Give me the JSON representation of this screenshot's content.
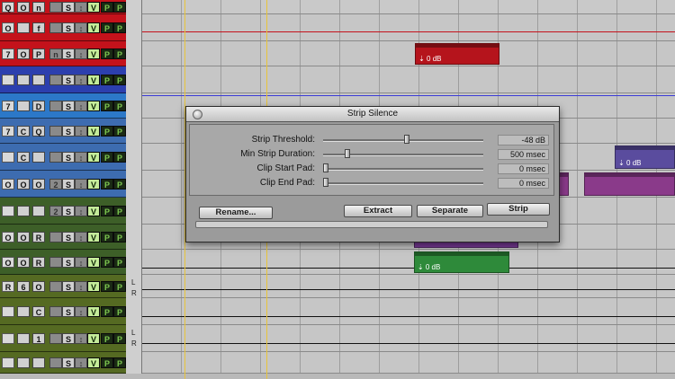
{
  "tracks": [
    {
      "color": "#c4121b",
      "num": "Q",
      "b1": "O",
      "b2": "n",
      "h": 16,
      "lane": "#c9c9c9"
    },
    {
      "color": "#c4121b",
      "num": "O",
      "b1": "",
      "b2": "f",
      "h": 30,
      "lane": "#c6c6c6"
    },
    {
      "color": "#c4121b",
      "num": "7",
      "b1": "O",
      "b2": "P",
      "b3": "n",
      "h": 28,
      "lane": "#c6c6c6"
    },
    {
      "color": "#2c3fae",
      "num": "",
      "b1": "",
      "b2": "",
      "h": 30,
      "lane": "#c6c6c6"
    },
    {
      "color": "#2c78c8",
      "num": "7",
      "b1": "",
      "b2": "D",
      "b3": "",
      "h": 28,
      "lane": "#c6c6c6"
    },
    {
      "color": "#3d6cb0",
      "num": "7",
      "b1": "C",
      "b2": "Q",
      "b3": "",
      "h": 28,
      "lane": "#c6c6c6"
    },
    {
      "color": "#3d6cb0",
      "num": "",
      "b1": "C",
      "b2": "",
      "b3": "",
      "h": 30,
      "lane": "#c6c6c6"
    },
    {
      "color": "#3d6cb0",
      "num": "O",
      "b1": "O",
      "b2": "O",
      "b3": "2",
      "h": 30,
      "lane": "#c6c6c6"
    },
    {
      "color": "#3d5f28",
      "num": "",
      "b1": "",
      "b2": "",
      "b3": "2",
      "h": 30,
      "lane": "#c6c6c6"
    },
    {
      "color": "#3d5f28",
      "num": "O",
      "b1": "O",
      "b2": "R",
      "b3": "",
      "h": 28,
      "lane": "#c6c6c6"
    },
    {
      "color": "#3d5f28",
      "num": "O",
      "b1": "O",
      "b2": "R",
      "b3": "",
      "h": 28,
      "lane": "#c6c6c6"
    },
    {
      "color": "#556a22",
      "num": "R",
      "b1": "6",
      "b2": "O",
      "b3": "",
      "h": 26,
      "lane": "#c6c6c6"
    },
    {
      "color": "#556a22",
      "num": "",
      "b1": "",
      "b2": "C",
      "b3": "",
      "h": 30,
      "lane": "#c6c6c6"
    },
    {
      "color": "#556a22",
      "num": "",
      "b1": "",
      "b2": "1",
      "b3": "",
      "h": 30,
      "lane": "#c6c6c6"
    },
    {
      "color": "#556a22",
      "num": "",
      "b1": "",
      "b2": "",
      "b3": "",
      "h": 24,
      "lane": "#c6c6c6"
    }
  ],
  "track_buttons": {
    "solo": "S",
    "voice": "V",
    "playlist": "P"
  },
  "clips": [
    {
      "track": 2,
      "label": "⇣ 0 dB",
      "color": "#b5141c",
      "start": 0.512,
      "width": 0.158
    },
    {
      "track": 6,
      "label": "⇣ 0 dB",
      "color": "#5a4c9e",
      "start": 0.887,
      "width": 0.113
    },
    {
      "track": 7,
      "label": "",
      "color": "#8a3a8a",
      "start": 0.78,
      "width": 0.02
    },
    {
      "track": 7,
      "label": "",
      "color": "#8a3a8a",
      "start": 0.83,
      "width": 0.17
    },
    {
      "track": 9,
      "label": "",
      "color": "#7a3a9a",
      "start": 0.51,
      "width": 0.196
    },
    {
      "track": 10,
      "label": "⇣ 0 dB",
      "color": "#2e8a3a",
      "start": 0.51,
      "width": 0.18
    }
  ],
  "dialog": {
    "title": "Strip Silence",
    "rows": [
      {
        "label": "Strip Threshold:",
        "value": "-48 dB",
        "position": 0.52
      },
      {
        "label": "Min Strip Duration:",
        "value": "500 msec",
        "position": 0.15
      },
      {
        "label": "Clip Start Pad:",
        "value": "0 msec",
        "position": 0.0
      },
      {
        "label": "Clip End Pad:",
        "value": "0 msec",
        "position": 0.0
      }
    ],
    "rename_label": "Rename...",
    "extract_label": "Extract",
    "separate_label": "Separate",
    "strip_label": "Strip"
  },
  "colors": {
    "playhead": "#e8c43a",
    "accent_red": "#c4121b",
    "accent_blue": "#2c78c8",
    "accent_green": "#3d5f28"
  }
}
